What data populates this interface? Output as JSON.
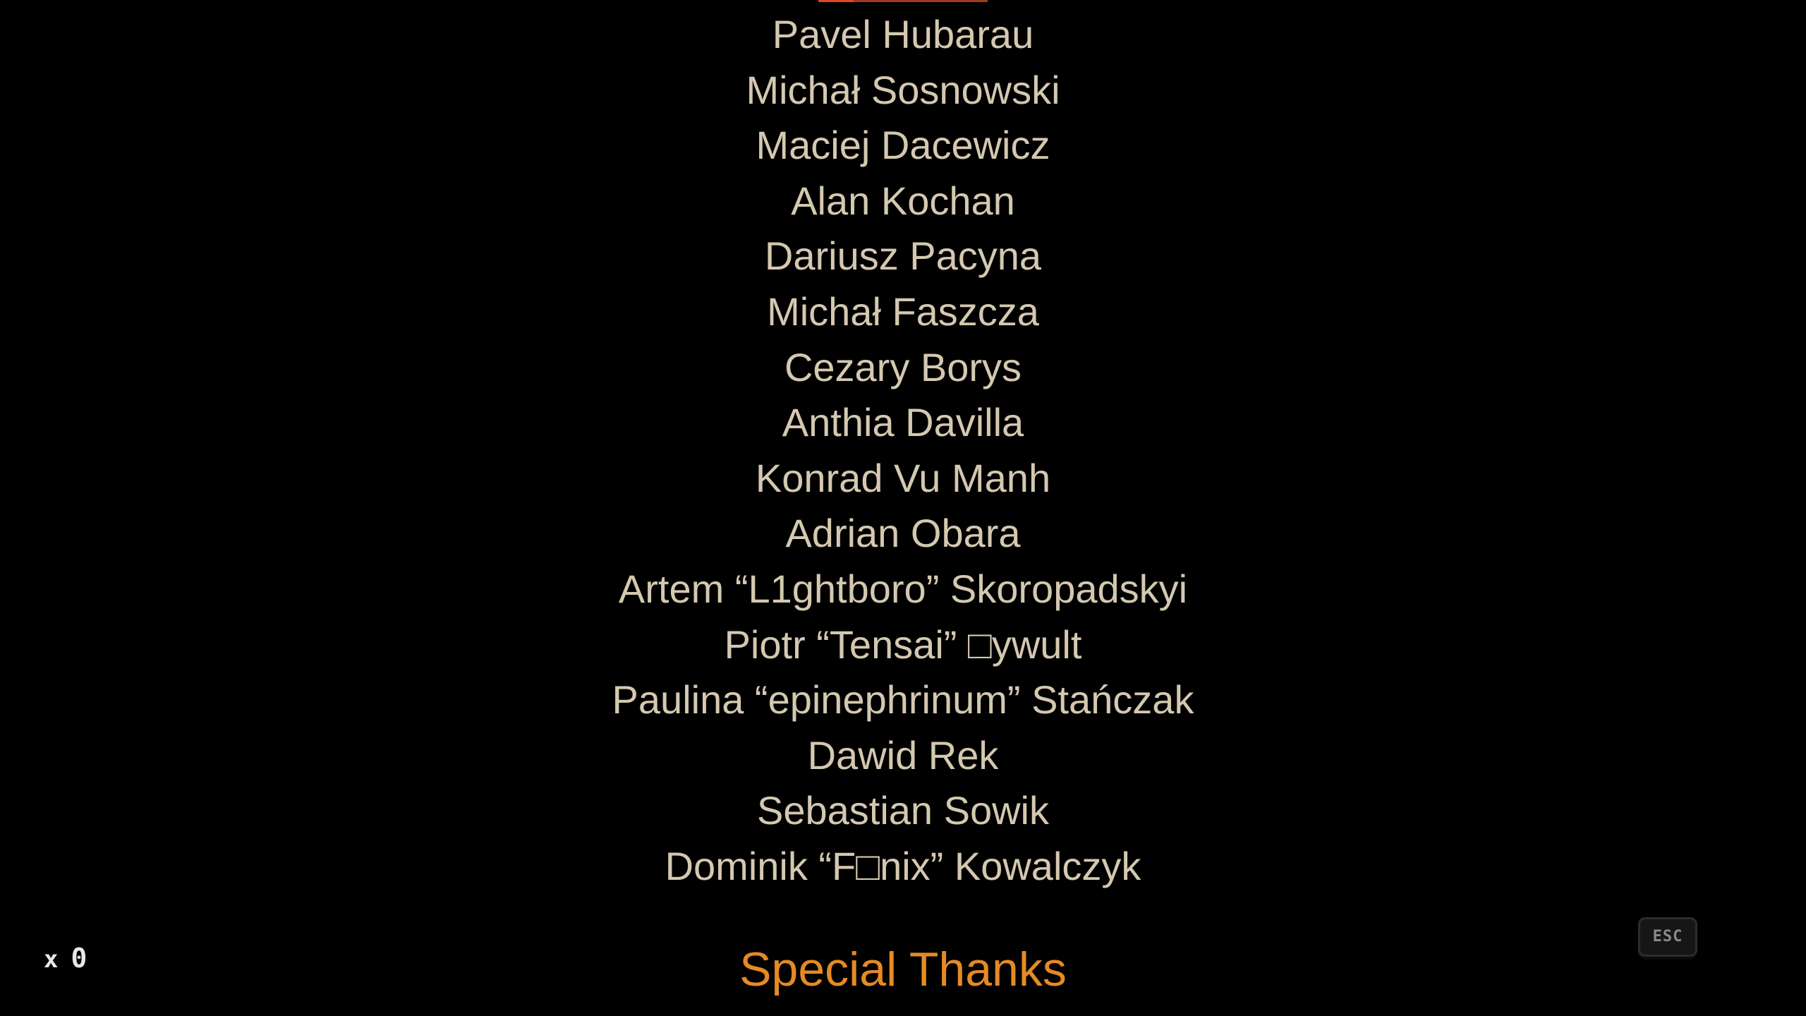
{
  "credits": {
    "names": [
      "Pavel Hubarau",
      "Michał Sosnowski",
      "Maciej Dacewicz",
      "Alan Kochan",
      "Dariusz Pacyna",
      "Michał Faszcza",
      "Cezary Borys",
      "Anthia Davilla",
      "Konrad Vu Manh",
      "Adrian Obara",
      "Artem “L1ghtboro” Skoropadskyi",
      "Piotr “Tensai” □ywult",
      "Paulina “epinephrinum” Stańczak",
      "Dawid Rek",
      "Sebastian Sowik",
      "Dominik “F□nix” Kowalczyk"
    ],
    "section_heading": "Special Thanks"
  },
  "hud": {
    "counter_symbol": "x",
    "counter_value": "0",
    "skip_key_label": "ESC"
  },
  "colors": {
    "background": "#000000",
    "credit_text": "#d4c8b0",
    "heading_text": "#e58a24",
    "top_bar": "#a03a1e"
  }
}
